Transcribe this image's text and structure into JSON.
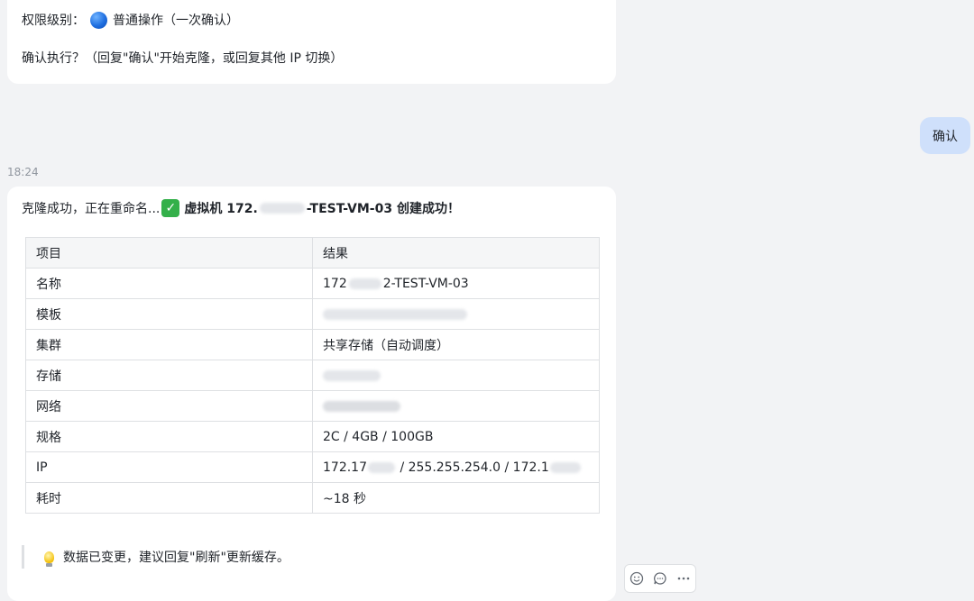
{
  "previous_message": {
    "permission_label": "权限级别：",
    "permission_value": "普通操作（一次确认）",
    "confirm_prompt": "确认执行？（回复\"确认\"开始克隆，或回复其他 IP 切换）"
  },
  "user_message": {
    "text": "确认"
  },
  "timestamp": "18:24",
  "reply": {
    "head_prefix": "克隆成功，正在重命名...",
    "head_bold_a": "虚拟机 172.",
    "head_bold_b": "-TEST-VM-03 创建成功！",
    "table": {
      "headers": [
        "项目",
        "结果"
      ],
      "rows": [
        {
          "label": "名称",
          "value_a": "172",
          "value_b": "2-TEST-VM-03"
        },
        {
          "label": "模板",
          "value_a": "",
          "value_b": ""
        },
        {
          "label": "集群",
          "value_a": "共享存储（自动调度）",
          "value_b": ""
        },
        {
          "label": "存储",
          "value_a": "",
          "value_b": ""
        },
        {
          "label": "网络",
          "value_a": "",
          "value_b": ""
        },
        {
          "label": "规格",
          "value_a": "2C / 4GB / 100GB",
          "value_b": ""
        },
        {
          "label": "IP",
          "value_a": "172.17",
          "value_b": " / 255.255.254.0 / 172.1"
        },
        {
          "label": "耗时",
          "value_a": "~18 秒",
          "value_b": ""
        }
      ]
    },
    "tip": "数据已变更，建议回复\"刷新\"更新缓存。"
  },
  "icons": {
    "permission": "blue-circle-icon",
    "success": "check-mark-icon",
    "tip": "light-bulb-icon",
    "toolbar": [
      "emoji-reaction-icon",
      "comment-icon",
      "more-icon"
    ]
  }
}
